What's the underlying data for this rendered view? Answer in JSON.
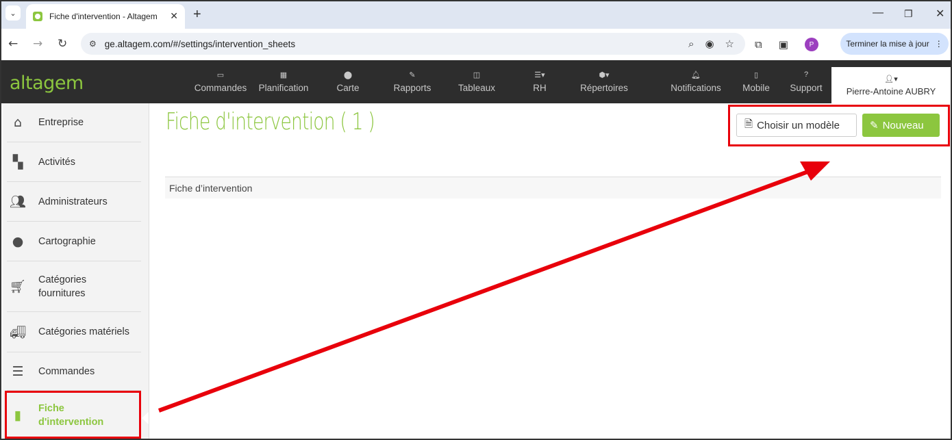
{
  "browser": {
    "tab_title": "Fiche d'intervention - Altagem",
    "url": "ge.altagem.com/#/settings/intervention_sheets",
    "profile_initial": "P",
    "update_button": "Terminer la mise à jour"
  },
  "app": {
    "logo": "altagem",
    "nav": [
      {
        "label": "Commandes",
        "icon": "inbox-icon"
      },
      {
        "label": "Planification",
        "icon": "calendar-icon"
      },
      {
        "label": "Carte",
        "icon": "map-marker-icon"
      },
      {
        "label": "Rapports",
        "icon": "edit-icon"
      },
      {
        "label": "Tableaux",
        "icon": "columns-icon"
      },
      {
        "label": "RH",
        "icon": "list-icon"
      },
      {
        "label": "Répertoires",
        "icon": "cube-icon"
      },
      {
        "label": "Notifications",
        "icon": "bell-icon"
      },
      {
        "label": "Mobile",
        "icon": "mobile-icon"
      },
      {
        "label": "Support",
        "icon": "question-icon"
      }
    ],
    "user": "Pierre-Antoine AUBRY"
  },
  "sidebar": {
    "items": [
      {
        "label": "Entreprise",
        "icon": "home-icon"
      },
      {
        "label": "Activités",
        "icon": "grid-icon"
      },
      {
        "label": "Administrateurs",
        "icon": "users-icon"
      },
      {
        "label": "Cartographie",
        "icon": "map-marker-icon"
      },
      {
        "label": "Catégories\nfournitures",
        "icon": "cart-icon"
      },
      {
        "label": "Catégories matériels",
        "icon": "truck-icon"
      },
      {
        "label": "Commandes",
        "icon": "list-icon"
      },
      {
        "label": "Fiche\nd'intervention",
        "icon": "file-icon",
        "active": true
      }
    ]
  },
  "main": {
    "title": "Fiche d'intervention ( 1 )",
    "choose_model_button": "Choisir un modèle",
    "new_button": "Nouveau",
    "table_header": "Fiche d’intervention"
  },
  "colors": {
    "accent": "#8cc63f",
    "annotation": "#e8000b",
    "navbar": "#2d2d2d"
  }
}
